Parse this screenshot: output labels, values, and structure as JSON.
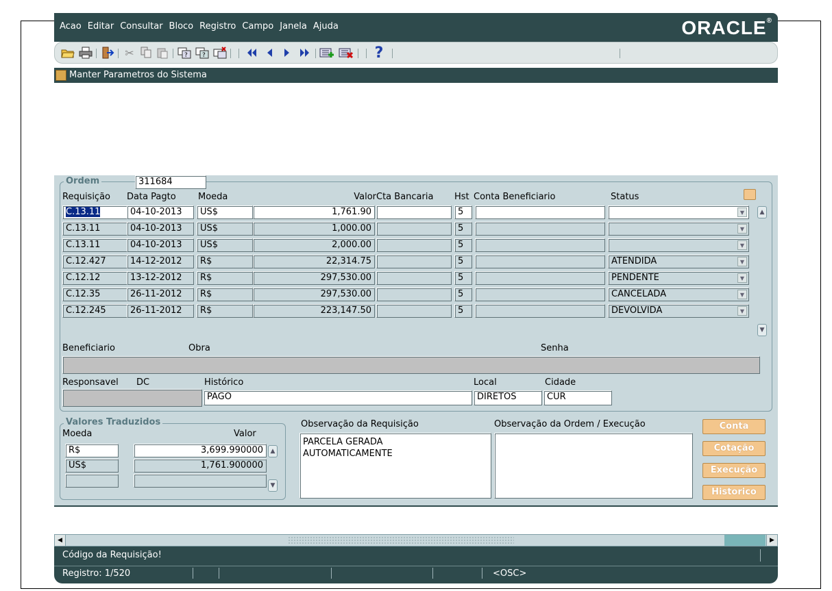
{
  "menu": [
    {
      "label": "Acao",
      "key": "A"
    },
    {
      "label": "Editar",
      "key": "E"
    },
    {
      "label": "Consultar",
      "key": "C"
    },
    {
      "label": "Bloco",
      "key": "B"
    },
    {
      "label": "Registro",
      "key": "R"
    },
    {
      "label": "Campo",
      "key": "C"
    },
    {
      "label": "Janela",
      "key": "J"
    },
    {
      "label": "Ajuda",
      "key": "A"
    }
  ],
  "brand": "ORACLE",
  "window_title": "Manter Parametros do Sistema",
  "ordem": {
    "group_label": "Ordem",
    "value": "311684"
  },
  "grid": {
    "headers": {
      "requisicao": "Requisição",
      "data_pagto": "Data Pagto",
      "moeda": "Moeda",
      "valor": "Valor",
      "cta_bancaria": "Cta Bancaria",
      "hst": "Hst",
      "conta_beneficiario": "Conta Beneficiario",
      "status": "Status"
    },
    "rows": [
      {
        "requisicao": "C.13.11",
        "data": "04-10-2013",
        "moeda": "US$",
        "valor": "1,761.90",
        "cta": "",
        "hst": "5",
        "conta": "",
        "status": ""
      },
      {
        "requisicao": "C.13.11",
        "data": "04-10-2013",
        "moeda": "US$",
        "valor": "1,000.00",
        "cta": "",
        "hst": "5",
        "conta": "",
        "status": ""
      },
      {
        "requisicao": "C.13.11",
        "data": "04-10-2013",
        "moeda": "US$",
        "valor": "2,000.00",
        "cta": "",
        "hst": "5",
        "conta": "",
        "status": ""
      },
      {
        "requisicao": "C.12.427",
        "data": "14-12-2012",
        "moeda": "R$",
        "valor": "22,314.75",
        "cta": "",
        "hst": "5",
        "conta": "",
        "status": "ATENDIDA"
      },
      {
        "requisicao": "C.12.12",
        "data": "13-12-2012",
        "moeda": "R$",
        "valor": "297,530.00",
        "cta": "",
        "hst": "5",
        "conta": "",
        "status": "PENDENTE"
      },
      {
        "requisicao": "C.12.35",
        "data": "26-11-2012",
        "moeda": "R$",
        "valor": "297,530.00",
        "cta": "",
        "hst": "5",
        "conta": "",
        "status": "CANCELADA"
      },
      {
        "requisicao": "C.12.245",
        "data": "26-11-2012",
        "moeda": "R$",
        "valor": "223,147.50",
        "cta": "",
        "hst": "5",
        "conta": "",
        "status": "DEVOLVIDA"
      }
    ]
  },
  "details": {
    "beneficiario_label": "Beneficiario",
    "obra_label": "Obra",
    "senha_label": "Senha",
    "responsavel_label": "Responsavel",
    "dc_label": "DC",
    "historico_label": "Histórico",
    "historico_value": "PAGO",
    "local_label": "Local",
    "local_value": "DIRETOS",
    "cidade_label": "Cidade",
    "cidade_value": "CUR"
  },
  "valores": {
    "group_label": "Valores Traduzidos",
    "moeda_label": "Moeda",
    "valor_label": "Valor",
    "rows": [
      {
        "moeda": "R$",
        "valor": "3,699.990000"
      },
      {
        "moeda": "US$",
        "valor": "1,761.900000"
      },
      {
        "moeda": "",
        "valor": ""
      }
    ]
  },
  "obs_requisicao": {
    "label": "Observação da Requisição",
    "text": "PARCELA GERADA\nAUTOMATICAMENTE"
  },
  "obs_ordem": {
    "label": "Observação da Ordem / Execução",
    "text": ""
  },
  "buttons": {
    "conta": "Conta",
    "cotacao": "Cotação",
    "execucao": "Execução",
    "historico": "Historico"
  },
  "status": {
    "message": "Código da Requisição!",
    "registro": "Registro: 1/520",
    "osc": "<OSC>"
  },
  "colors": {
    "title_bar": "#2e4a4c",
    "panel": "#c9d8dc",
    "button": "#f3c68c",
    "selection": "#0a2a86"
  }
}
